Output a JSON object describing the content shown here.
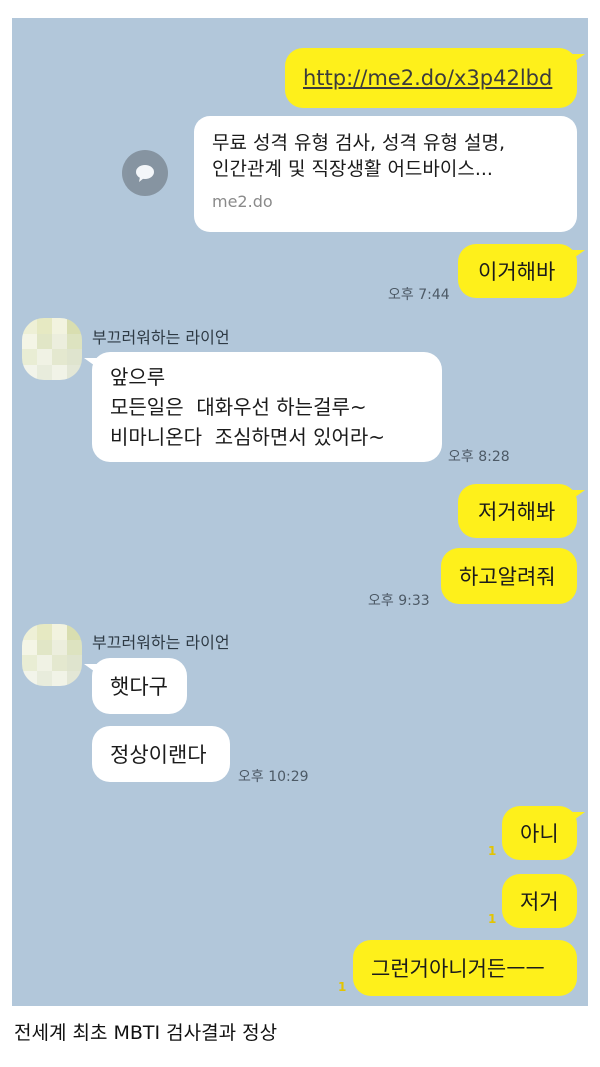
{
  "messages": {
    "link_url": "http://me2.do/x3p42lbd",
    "link_card_line1": "무료 성격 유형 검사, 성격 유형 설명,",
    "link_card_line2": "인간관계 및 직장생활 어드바이스...",
    "link_card_domain": "me2.do",
    "me_1": "이거해바",
    "time_1": "오후 7:44",
    "sender_name": "부끄러워하는 라이언",
    "them_1_line1": "앞으루",
    "them_1_line2": "모든일은  대화우선 하는걸루~",
    "them_1_line3": "비마니온다  조심하면서 있어라~",
    "time_2": "오후 8:28",
    "me_2": "저거해봐",
    "me_3": "하고알려줘",
    "time_3": "오후 9:33",
    "them_2": "햇다구",
    "them_3": "정상이랜다",
    "time_4": "오후 10:29",
    "me_4": "아니",
    "me_5": "저거",
    "me_6": "그런거아니거든ㅡㅡ",
    "unread_count": "1"
  },
  "caption": "전세계 최초 MBTI 검사결과 정상",
  "colors": {
    "chat_background": "#b2c7da",
    "my_bubble": "#fef01b",
    "their_bubble": "#ffffff"
  },
  "icons": {
    "share": "share-icon",
    "avatar": "profile-avatar"
  }
}
